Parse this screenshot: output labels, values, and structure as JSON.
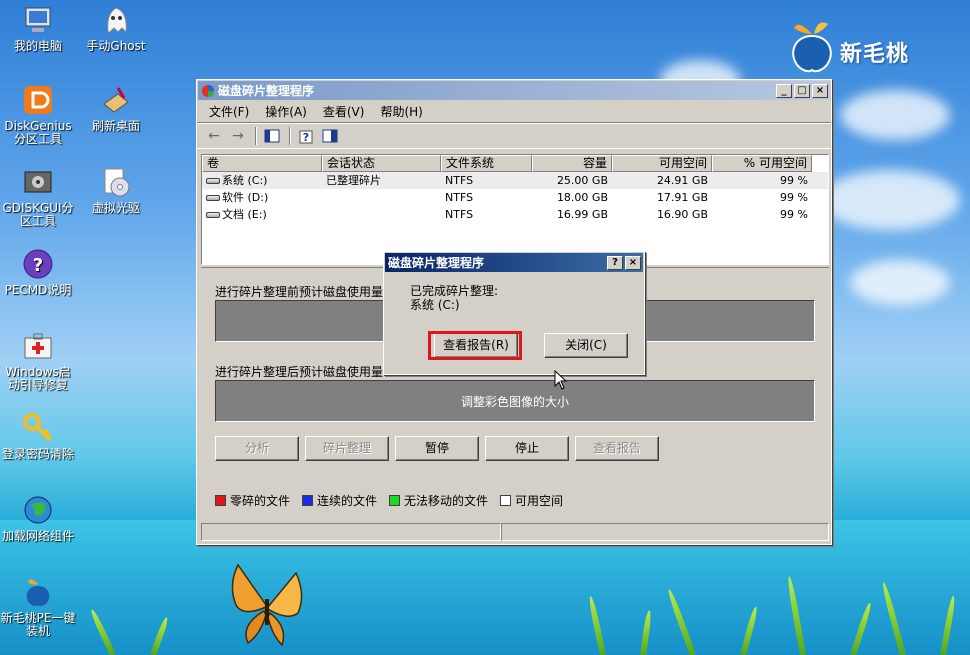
{
  "desktop": {
    "icons": [
      {
        "label": "我的电脑",
        "icon": "computer-icon"
      },
      {
        "label": "手动Ghost",
        "icon": "ghost-icon"
      },
      {
        "label": "DiskGenius分区工具",
        "icon": "diskgenius-icon"
      },
      {
        "label": "刷新桌面",
        "icon": "refresh-desktop-icon"
      },
      {
        "label": "GDISKGUI分区工具",
        "icon": "gdiskgui-icon"
      },
      {
        "label": "虚拟光驱",
        "icon": "virtual-cdrom-icon"
      },
      {
        "label": "PECMD说明",
        "icon": "help-icon"
      },
      {
        "label": "Windows启动引导修复",
        "icon": "first-aid-icon"
      },
      {
        "label": "登录密码清除",
        "icon": "key-icon"
      },
      {
        "label": "加载网络组件",
        "icon": "network-globe-icon"
      },
      {
        "label": "新毛桃PE一键装机",
        "icon": "peach-icon"
      }
    ],
    "logo_text": "新毛桃"
  },
  "window": {
    "title": "磁盘碎片整理程序",
    "controls": {
      "minimize": "_",
      "maximize": "□",
      "close": "×"
    },
    "menu": [
      "文件(F)",
      "操作(A)",
      "查看(V)",
      "帮助(H)"
    ],
    "toolbar": [
      "back-arrow-icon",
      "forward-arrow-icon",
      "console-tree-icon",
      "properties-help-icon",
      "show-hide-icon"
    ],
    "columns": [
      "卷",
      "会话状态",
      "文件系统",
      "容量",
      "可用空间",
      "% 可用空间"
    ],
    "volumes": [
      {
        "name": "系统 (C:)",
        "status": "已整理碎片",
        "fs": "NTFS",
        "capacity": "25.00 GB",
        "free": "24.91 GB",
        "pct": "99 %"
      },
      {
        "name": "软件 (D:)",
        "status": "",
        "fs": "NTFS",
        "capacity": "18.00 GB",
        "free": "17.91 GB",
        "pct": "99 %"
      },
      {
        "name": "文档 (E:)",
        "status": "",
        "fs": "NTFS",
        "capacity": "16.99 GB",
        "free": "16.90 GB",
        "pct": "99 %"
      }
    ],
    "before_label": "进行碎片整理前预计磁盘使用量",
    "after_label": "进行碎片整理后预计磁盘使用量",
    "after_display_text": "调整彩色图像的大小",
    "buttons": {
      "analyze": "分析",
      "defrag": "碎片整理",
      "pause": "暂停",
      "stop": "停止",
      "report": "查看报告"
    },
    "legend": [
      {
        "label": "零碎的文件",
        "color": "#e0161c"
      },
      {
        "label": "连续的文件",
        "color": "#1a2ee8"
      },
      {
        "label": "无法移动的文件",
        "color": "#1ed62a"
      },
      {
        "label": "可用空间",
        "color": "#ffffff"
      }
    ]
  },
  "dialog": {
    "title": "磁盘碎片整理程序",
    "help": "?",
    "close": "×",
    "message_line1": "已完成碎片整理:",
    "message_line2": "系统 (C:)",
    "view_report": "查看报告(R)",
    "close_button": "关闭(C)"
  }
}
